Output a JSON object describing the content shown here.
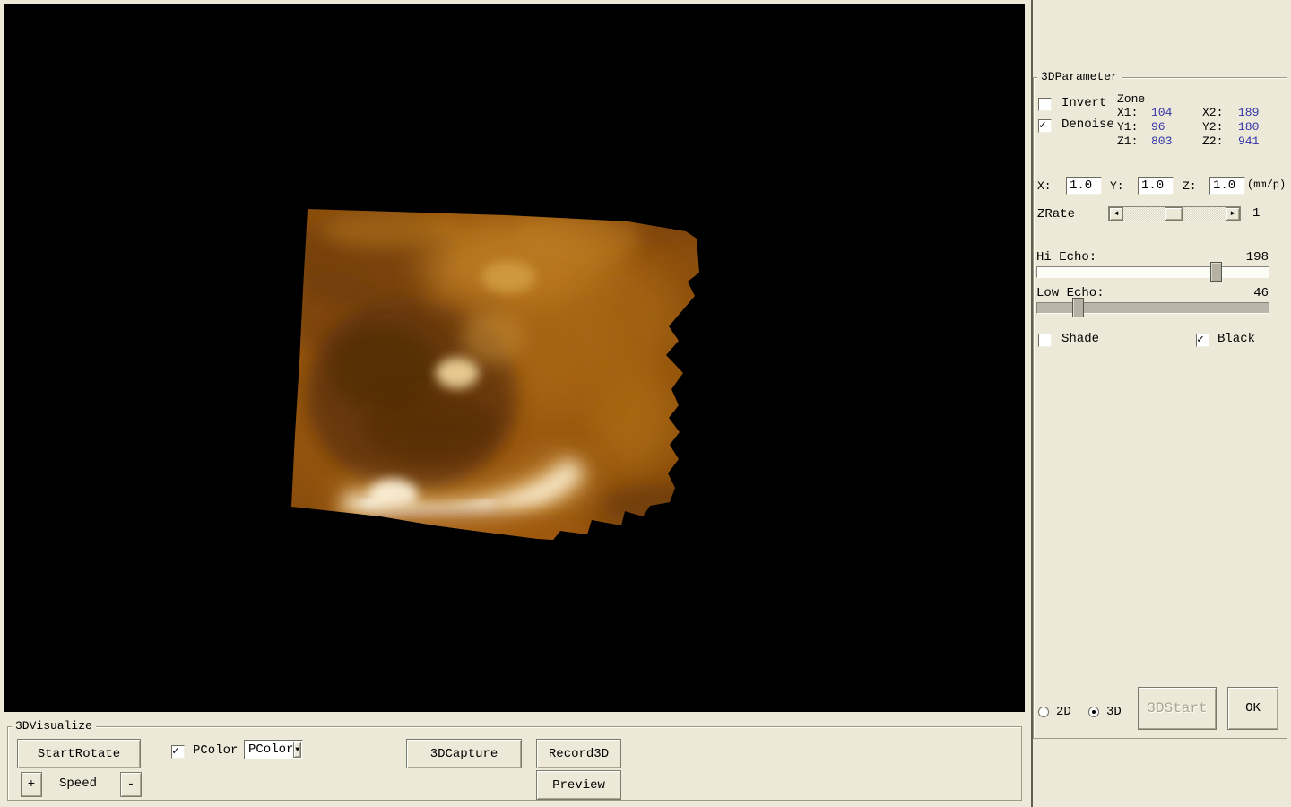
{
  "icons": {
    "check": "✓",
    "dropdown_arrow": "▼",
    "scroll_left": "◄",
    "scroll_right": "►"
  },
  "parameter_panel": {
    "title": "3DParameter",
    "invert": {
      "label": "Invert",
      "checked": false
    },
    "denoise": {
      "label": "Denoise",
      "checked": true
    },
    "zone": {
      "label": "Zone",
      "x1_label": "X1:",
      "x1": "104",
      "x2_label": "X2:",
      "x2": "189",
      "y1_label": "Y1:",
      "y1": "96",
      "y2_label": "Y2:",
      "y2": "180",
      "z1_label": "Z1:",
      "z1": "803",
      "z2_label": "Z2:",
      "z2": "941",
      "value_color": "#3535A8"
    },
    "scale": {
      "x_label": "X:",
      "x_value": "1.0",
      "y_label": "Y:",
      "y_value": "1.0",
      "z_label": "Z:",
      "z_value": "1.0",
      "unit": "(mm/p)"
    },
    "zrate": {
      "label": "ZRate",
      "value": "1"
    },
    "hi_echo": {
      "label": "Hi Echo:",
      "value": 198,
      "max": 255
    },
    "low_echo": {
      "label": "Low Echo:",
      "value": 46,
      "max": 255
    },
    "shade": {
      "label": "Shade",
      "checked": false
    },
    "black": {
      "label": "Black",
      "checked": true
    },
    "mode_2d": {
      "label": "2D",
      "selected": false
    },
    "mode_3d": {
      "label": "3D",
      "selected": true
    },
    "start_button": "3DStart",
    "ok_button": "OK"
  },
  "visualize_panel": {
    "title": "3DVisualize",
    "start_rotate": "StartRotate",
    "pcolor_checkbox": {
      "label": "PColor",
      "checked": true
    },
    "pcolor_dropdown_value": "PColor",
    "capture_button": "3DCapture",
    "record_button": "Record3D",
    "preview_button": "Preview",
    "speed_plus": "+",
    "speed_label": "Speed",
    "speed_minus": "-"
  }
}
